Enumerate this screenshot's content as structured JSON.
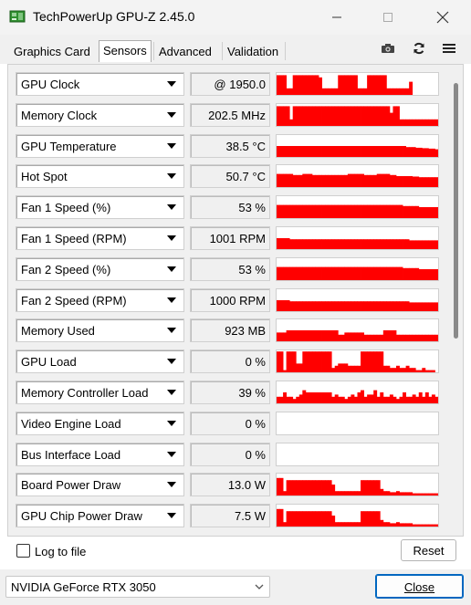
{
  "window": {
    "title": "TechPowerUp GPU-Z 2.45.0"
  },
  "tabs": [
    {
      "label": "Graphics Card",
      "selected": false
    },
    {
      "label": "Sensors",
      "selected": true
    },
    {
      "label": "Advanced",
      "selected": false
    },
    {
      "label": "Validation",
      "selected": false
    }
  ],
  "toolbar_icons": [
    "camera-icon",
    "refresh-icon",
    "hamburger-menu-icon"
  ],
  "graph_color": "#ff0000",
  "sensors": [
    {
      "label": "GPU Clock",
      "value": "@ 1950.0",
      "trace": [
        0.9,
        0.9,
        0.9,
        0.3,
        0.3,
        0.9,
        0.9,
        0.9,
        0.9,
        0.9,
        0.9,
        0.9,
        0.9,
        0.8,
        0.3,
        0.3,
        0.3,
        0.3,
        0.3,
        0.9,
        0.9,
        0.9,
        0.9,
        0.9,
        0.9,
        0.3,
        0.3,
        0.3,
        0.9,
        0.9,
        0.9,
        0.9,
        0.9,
        0.9,
        0.3,
        0.3,
        0.3,
        0.3,
        0.3,
        0.3,
        0.3,
        0.6,
        0,
        0,
        0,
        0,
        0,
        0,
        0,
        0
      ]
    },
    {
      "label": "Memory Clock",
      "value": "202.5 MHz",
      "trace": [
        0.9,
        0.9,
        0.9,
        0.9,
        0.3,
        0.9,
        0.9,
        0.9,
        0.9,
        0.9,
        0.9,
        0.9,
        0.9,
        0.9,
        0.9,
        0.9,
        0.9,
        0.9,
        0.9,
        0.9,
        0.9,
        0.9,
        0.9,
        0.9,
        0.9,
        0.9,
        0.9,
        0.9,
        0.9,
        0.9,
        0.9,
        0.9,
        0.9,
        0.9,
        0.9,
        0.6,
        0.9,
        0.9,
        0.3,
        0.3,
        0.3,
        0.3,
        0.3,
        0.3,
        0.3,
        0.3,
        0.3,
        0.3,
        0.3,
        0.3
      ]
    },
    {
      "label": "GPU Temperature",
      "value": "38.5 °C",
      "trace": [
        0.5,
        0.5,
        0.5,
        0.5,
        0.5,
        0.5,
        0.5,
        0.5,
        0.5,
        0.5,
        0.5,
        0.5,
        0.5,
        0.5,
        0.5,
        0.5,
        0.5,
        0.5,
        0.5,
        0.5,
        0.5,
        0.5,
        0.5,
        0.5,
        0.5,
        0.5,
        0.5,
        0.5,
        0.5,
        0.5,
        0.5,
        0.5,
        0.5,
        0.5,
        0.5,
        0.5,
        0.5,
        0.5,
        0.5,
        0.5,
        0.45,
        0.45,
        0.45,
        0.42,
        0.42,
        0.4,
        0.4,
        0.38,
        0.38,
        0.35
      ]
    },
    {
      "label": "Hot Spot",
      "value": "50.7 °C",
      "trace": [
        0.6,
        0.6,
        0.6,
        0.6,
        0.6,
        0.55,
        0.55,
        0.55,
        0.6,
        0.6,
        0.6,
        0.55,
        0.55,
        0.55,
        0.55,
        0.55,
        0.55,
        0.55,
        0.55,
        0.55,
        0.55,
        0.55,
        0.6,
        0.6,
        0.6,
        0.6,
        0.6,
        0.55,
        0.55,
        0.55,
        0.55,
        0.6,
        0.6,
        0.6,
        0.6,
        0.55,
        0.55,
        0.5,
        0.5,
        0.5,
        0.5,
        0.5,
        0.48,
        0.48,
        0.45,
        0.45,
        0.45,
        0.45,
        0.45,
        0.45
      ]
    },
    {
      "label": "Fan 1 Speed (%)",
      "value": "53 %",
      "trace": [
        0.6,
        0.6,
        0.6,
        0.6,
        0.6,
        0.6,
        0.6,
        0.6,
        0.6,
        0.6,
        0.6,
        0.6,
        0.6,
        0.6,
        0.6,
        0.6,
        0.6,
        0.6,
        0.6,
        0.6,
        0.6,
        0.6,
        0.6,
        0.6,
        0.6,
        0.6,
        0.6,
        0.6,
        0.6,
        0.6,
        0.6,
        0.6,
        0.6,
        0.6,
        0.6,
        0.6,
        0.6,
        0.6,
        0.6,
        0.55,
        0.55,
        0.55,
        0.55,
        0.55,
        0.5,
        0.5,
        0.5,
        0.5,
        0.5,
        0.5
      ]
    },
    {
      "label": "Fan 1 Speed (RPM)",
      "value": "1001 RPM",
      "trace": [
        0.5,
        0.5,
        0.5,
        0.5,
        0.45,
        0.45,
        0.45,
        0.45,
        0.45,
        0.45,
        0.45,
        0.45,
        0.45,
        0.45,
        0.45,
        0.45,
        0.45,
        0.45,
        0.45,
        0.45,
        0.45,
        0.45,
        0.45,
        0.45,
        0.45,
        0.45,
        0.45,
        0.45,
        0.45,
        0.45,
        0.45,
        0.45,
        0.45,
        0.45,
        0.45,
        0.45,
        0.45,
        0.45,
        0.45,
        0.45,
        0.45,
        0.4,
        0.4,
        0.4,
        0.4,
        0.4,
        0.4,
        0.4,
        0.4,
        0.4
      ]
    },
    {
      "label": "Fan 2 Speed (%)",
      "value": "53 %",
      "trace": [
        0.6,
        0.6,
        0.6,
        0.6,
        0.6,
        0.6,
        0.6,
        0.6,
        0.6,
        0.6,
        0.6,
        0.6,
        0.6,
        0.6,
        0.6,
        0.6,
        0.6,
        0.6,
        0.6,
        0.6,
        0.6,
        0.6,
        0.6,
        0.6,
        0.6,
        0.6,
        0.6,
        0.6,
        0.6,
        0.6,
        0.6,
        0.6,
        0.6,
        0.6,
        0.6,
        0.6,
        0.6,
        0.6,
        0.6,
        0.55,
        0.55,
        0.55,
        0.55,
        0.55,
        0.5,
        0.5,
        0.5,
        0.5,
        0.5,
        0.5
      ]
    },
    {
      "label": "Fan 2 Speed (RPM)",
      "value": "1000 RPM",
      "trace": [
        0.5,
        0.5,
        0.5,
        0.5,
        0.45,
        0.45,
        0.45,
        0.45,
        0.45,
        0.45,
        0.45,
        0.45,
        0.45,
        0.45,
        0.45,
        0.45,
        0.45,
        0.45,
        0.45,
        0.45,
        0.45,
        0.45,
        0.45,
        0.45,
        0.45,
        0.45,
        0.45,
        0.45,
        0.45,
        0.45,
        0.45,
        0.45,
        0.45,
        0.45,
        0.45,
        0.45,
        0.45,
        0.45,
        0.45,
        0.45,
        0.45,
        0.4,
        0.4,
        0.4,
        0.4,
        0.4,
        0.4,
        0.4,
        0.4,
        0.4
      ]
    },
    {
      "label": "Memory Used",
      "value": "923 MB",
      "trace": [
        0.4,
        0.4,
        0.4,
        0.5,
        0.5,
        0.5,
        0.5,
        0.5,
        0.5,
        0.5,
        0.5,
        0.5,
        0.5,
        0.5,
        0.5,
        0.5,
        0.5,
        0.5,
        0.5,
        0.3,
        0.3,
        0.4,
        0.4,
        0.4,
        0.4,
        0.4,
        0.4,
        0.3,
        0.3,
        0.3,
        0.3,
        0.3,
        0.3,
        0.5,
        0.5,
        0.5,
        0.5,
        0.3,
        0.3,
        0.3,
        0.3,
        0.3,
        0.3,
        0.3,
        0.3,
        0.3,
        0.3,
        0.3,
        0.3,
        0.3
      ]
    },
    {
      "label": "GPU Load",
      "value": "0 %",
      "trace": [
        0.95,
        0.95,
        0.1,
        0.95,
        0.95,
        0.95,
        0.4,
        0.4,
        0.95,
        0.95,
        0.95,
        0.95,
        0.95,
        0.95,
        0.95,
        0.95,
        0.95,
        0.2,
        0.3,
        0.4,
        0.4,
        0.4,
        0.3,
        0.3,
        0.3,
        0.3,
        0.95,
        0.95,
        0.95,
        0.95,
        0.95,
        0.95,
        0.95,
        0.3,
        0.3,
        0.2,
        0.2,
        0.3,
        0.2,
        0.2,
        0.3,
        0.2,
        0.2,
        0.1,
        0.1,
        0.2,
        0.1,
        0.1,
        0.1,
        0
      ]
    },
    {
      "label": "Memory Controller Load",
      "value": "39 %",
      "trace": [
        0.3,
        0.3,
        0.5,
        0.3,
        0.3,
        0.2,
        0.3,
        0.4,
        0.6,
        0.5,
        0.5,
        0.5,
        0.5,
        0.5,
        0.5,
        0.5,
        0.5,
        0.3,
        0.4,
        0.3,
        0.3,
        0.2,
        0.3,
        0.4,
        0.3,
        0.5,
        0.6,
        0.3,
        0.4,
        0.4,
        0.6,
        0.3,
        0.5,
        0.3,
        0.3,
        0.4,
        0.3,
        0.2,
        0.3,
        0.5,
        0.3,
        0.3,
        0.4,
        0.3,
        0.5,
        0.3,
        0.5,
        0.3,
        0.4,
        0.3
      ]
    },
    {
      "label": "Video Engine Load",
      "value": "0 %",
      "trace": []
    },
    {
      "label": "Bus Interface Load",
      "value": "0 %",
      "trace": []
    },
    {
      "label": "Board Power Draw",
      "value": "13.0 W",
      "trace": [
        0.8,
        0.8,
        0.2,
        0.7,
        0.7,
        0.7,
        0.7,
        0.7,
        0.7,
        0.7,
        0.7,
        0.7,
        0.7,
        0.7,
        0.7,
        0.7,
        0.7,
        0.5,
        0.2,
        0.2,
        0.2,
        0.2,
        0.2,
        0.2,
        0.2,
        0.2,
        0.7,
        0.7,
        0.7,
        0.7,
        0.7,
        0.7,
        0.3,
        0.2,
        0.2,
        0.15,
        0.15,
        0.2,
        0.15,
        0.15,
        0.15,
        0.15,
        0.1,
        0.1,
        0.1,
        0.1,
        0.1,
        0.1,
        0.1,
        0.1
      ]
    },
    {
      "label": "GPU Chip Power Draw",
      "value": "7.5 W",
      "trace": [
        0.8,
        0.8,
        0.2,
        0.7,
        0.7,
        0.7,
        0.7,
        0.7,
        0.7,
        0.7,
        0.7,
        0.7,
        0.7,
        0.7,
        0.7,
        0.7,
        0.7,
        0.5,
        0.2,
        0.2,
        0.2,
        0.2,
        0.2,
        0.2,
        0.2,
        0.2,
        0.7,
        0.7,
        0.7,
        0.7,
        0.7,
        0.7,
        0.3,
        0.2,
        0.2,
        0.15,
        0.15,
        0.2,
        0.15,
        0.15,
        0.15,
        0.15,
        0.1,
        0.1,
        0.1,
        0.1,
        0.1,
        0.1,
        0.1,
        0.1
      ]
    }
  ],
  "footer": {
    "log_to_file_label": "Log to file",
    "log_to_file_checked": false,
    "reset_label": "Reset",
    "gpu_select_value": "NVIDIA GeForce RTX 3050",
    "close_label": "Close"
  }
}
